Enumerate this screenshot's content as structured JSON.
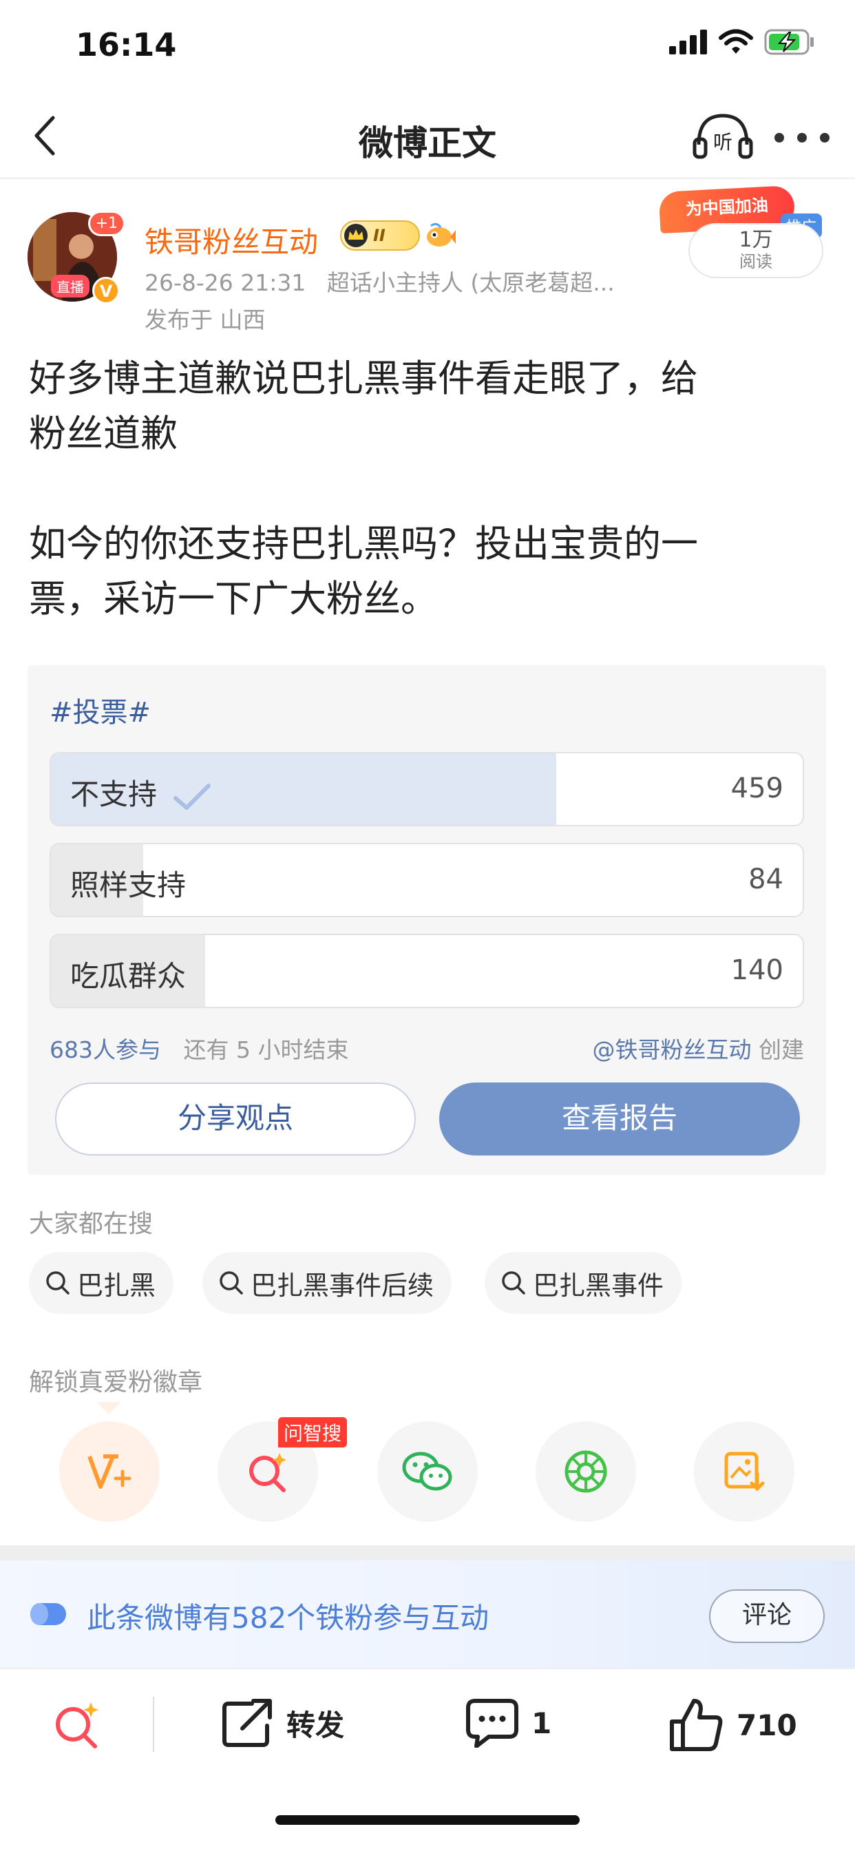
{
  "status_bar": {
    "time": "16:14"
  },
  "nav": {
    "title": "微博正文",
    "listen_icon_text": "听"
  },
  "author": {
    "name": "铁哥粉丝互动",
    "badge_level": "II",
    "avatar_plus": "+1",
    "avatar_live": "直播",
    "avatar_verified": "V",
    "time": "26-8-26 21:31",
    "role": "超话小主持人 (太原老葛超...",
    "location": "发布于 山西"
  },
  "promo": {
    "banner": "为中国加油",
    "tag": "推广",
    "reads": "1万",
    "reads_label": "阅读"
  },
  "post": {
    "line1": "好多博主道歉说巴扎黑事件看走眼了，给",
    "line2": "粉丝道歉",
    "line3": "如今的你还支持巴扎黑吗？投出宝贵的一",
    "line4": "票，采访一下广大粉丝。"
  },
  "vote": {
    "tag": "#投票#",
    "options": [
      {
        "label": "不支持",
        "count": "459",
        "share": 0.672,
        "selected": true
      },
      {
        "label": "照样支持",
        "count": "84",
        "share": 0.123,
        "selected": false
      },
      {
        "label": "吃瓜群众",
        "count": "140",
        "share": 0.205,
        "selected": false
      }
    ],
    "participants": "683人参与",
    "time_left": "还有 5 小时结束",
    "creator_handle": "@铁哥粉丝互动",
    "creator_suffix": "创建",
    "share_button": "分享观点",
    "report_button": "查看报告"
  },
  "hot_search": {
    "label": "大家都在搜",
    "chips": [
      "巴扎黑",
      "巴扎黑事件后续",
      "巴扎黑事件"
    ]
  },
  "fan_badges": {
    "label": "解锁真爱粉徽章",
    "tag": "问智搜",
    "icons": [
      "weibo-vplus-icon",
      "ai-search-icon",
      "wechat-icon",
      "moments-icon",
      "save-image-icon"
    ]
  },
  "interaction": {
    "text": "此条微博有582个铁粉参与互动",
    "comment_button": "评论"
  },
  "bottom_bar": {
    "repost": "转发",
    "comments": "1",
    "likes": "710"
  },
  "colors": {
    "accent_orange": "#f56a12",
    "link_blue": "#3a5d9e",
    "report_button": "#7294cb",
    "interaction_blue": "#4d7fd6"
  }
}
